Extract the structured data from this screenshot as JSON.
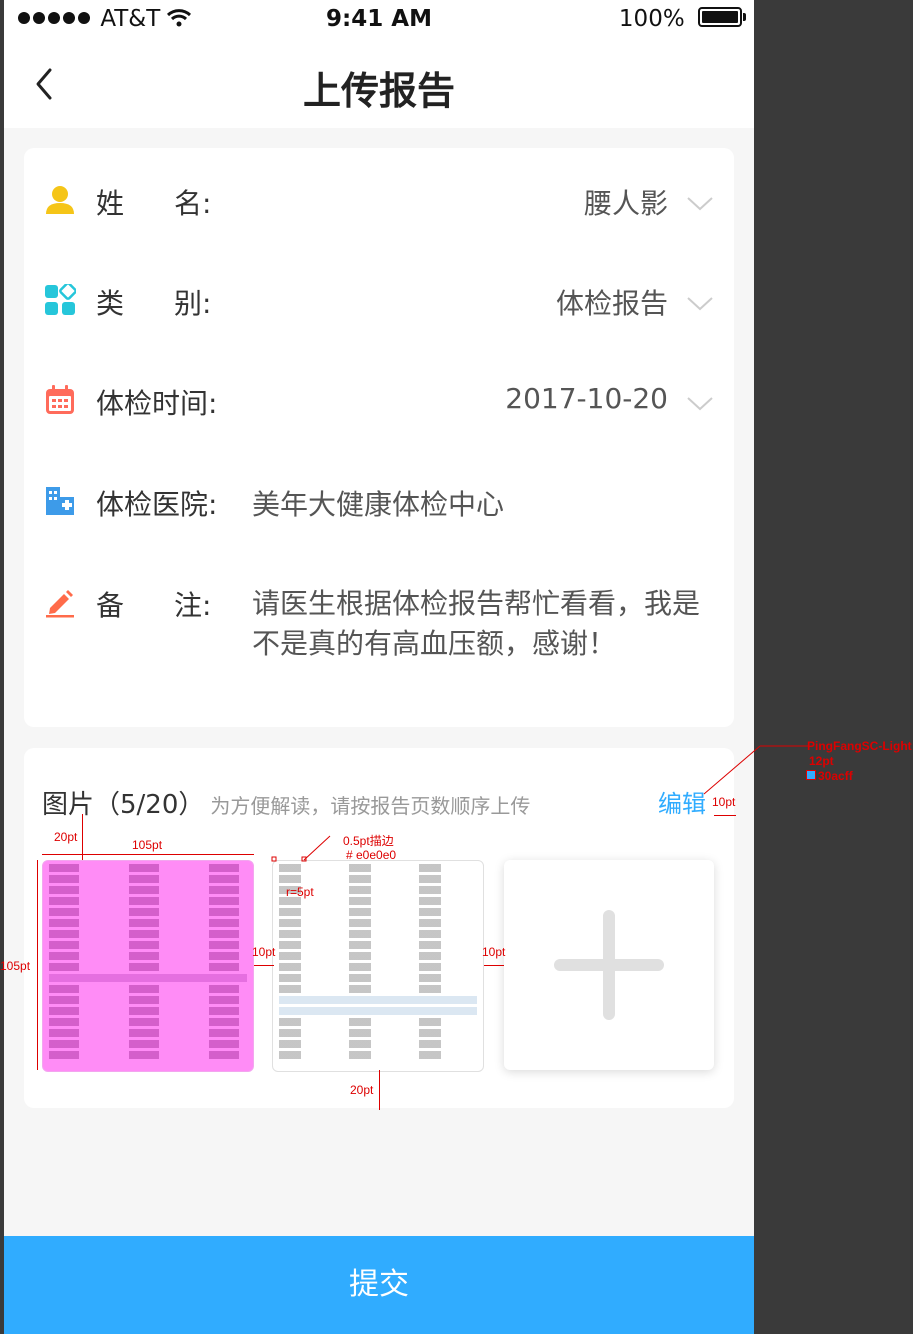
{
  "status_bar": {
    "carrier": "AT&T",
    "time": "9:41 AM",
    "battery": "100%"
  },
  "nav": {
    "title": "上传报告"
  },
  "form": {
    "name": {
      "label_a": "姓",
      "label_b": "名:",
      "value": "腰人影"
    },
    "category": {
      "label_a": "类",
      "label_b": "别:",
      "value": "体检报告"
    },
    "date": {
      "label": "体检时间:",
      "value": "2017-10-20"
    },
    "hospital": {
      "label": "体检医院:",
      "value": "美年大健康体检中心"
    },
    "remark": {
      "label_a": "备",
      "label_b": "注:",
      "value": "请医生根据体检报告帮忙看看，我是不是真的有高血压额，感谢！"
    }
  },
  "pictures": {
    "title": "图片（5/20）",
    "hint": "为方便解读，请按报告页数顺序上传",
    "edit_label": "编辑"
  },
  "submit_label": "提交",
  "annotations": {
    "font_note": "PingFangSC-Light",
    "size_note": "12pt",
    "color_note": "30acff",
    "margin_20pt_top": "20pt",
    "width_105pt": "105pt",
    "height_105pt": "105pt",
    "gap_10pt_a": "10pt",
    "gap_10pt_b": "10pt",
    "edit_margin": "10pt",
    "bottom_20pt": "20pt",
    "stroke_note": "0.5pt描边",
    "stroke_color": "# e0e0e0",
    "radius_note": "r=5pt"
  },
  "colors": {
    "accent": "#30acff",
    "background": "#f6f6f6",
    "card": "#ffffff",
    "border": "#e0e0e0"
  }
}
